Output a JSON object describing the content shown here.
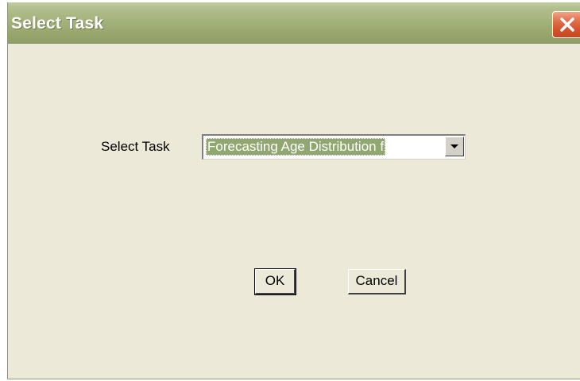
{
  "window": {
    "title": "Select Task"
  },
  "form": {
    "task_label": "Select Task",
    "task_selected": "Forecasting Age Distribution f"
  },
  "buttons": {
    "ok_label": "OK",
    "cancel_label": "Cancel"
  },
  "icons": {
    "close": "close-icon",
    "dropdown": "chevron-down-icon"
  },
  "colors": {
    "titlebar": "#a4b27c",
    "dialog_background": "#ece9d8",
    "close_button": "#d4522c",
    "selection_highlight": "#90a870"
  }
}
